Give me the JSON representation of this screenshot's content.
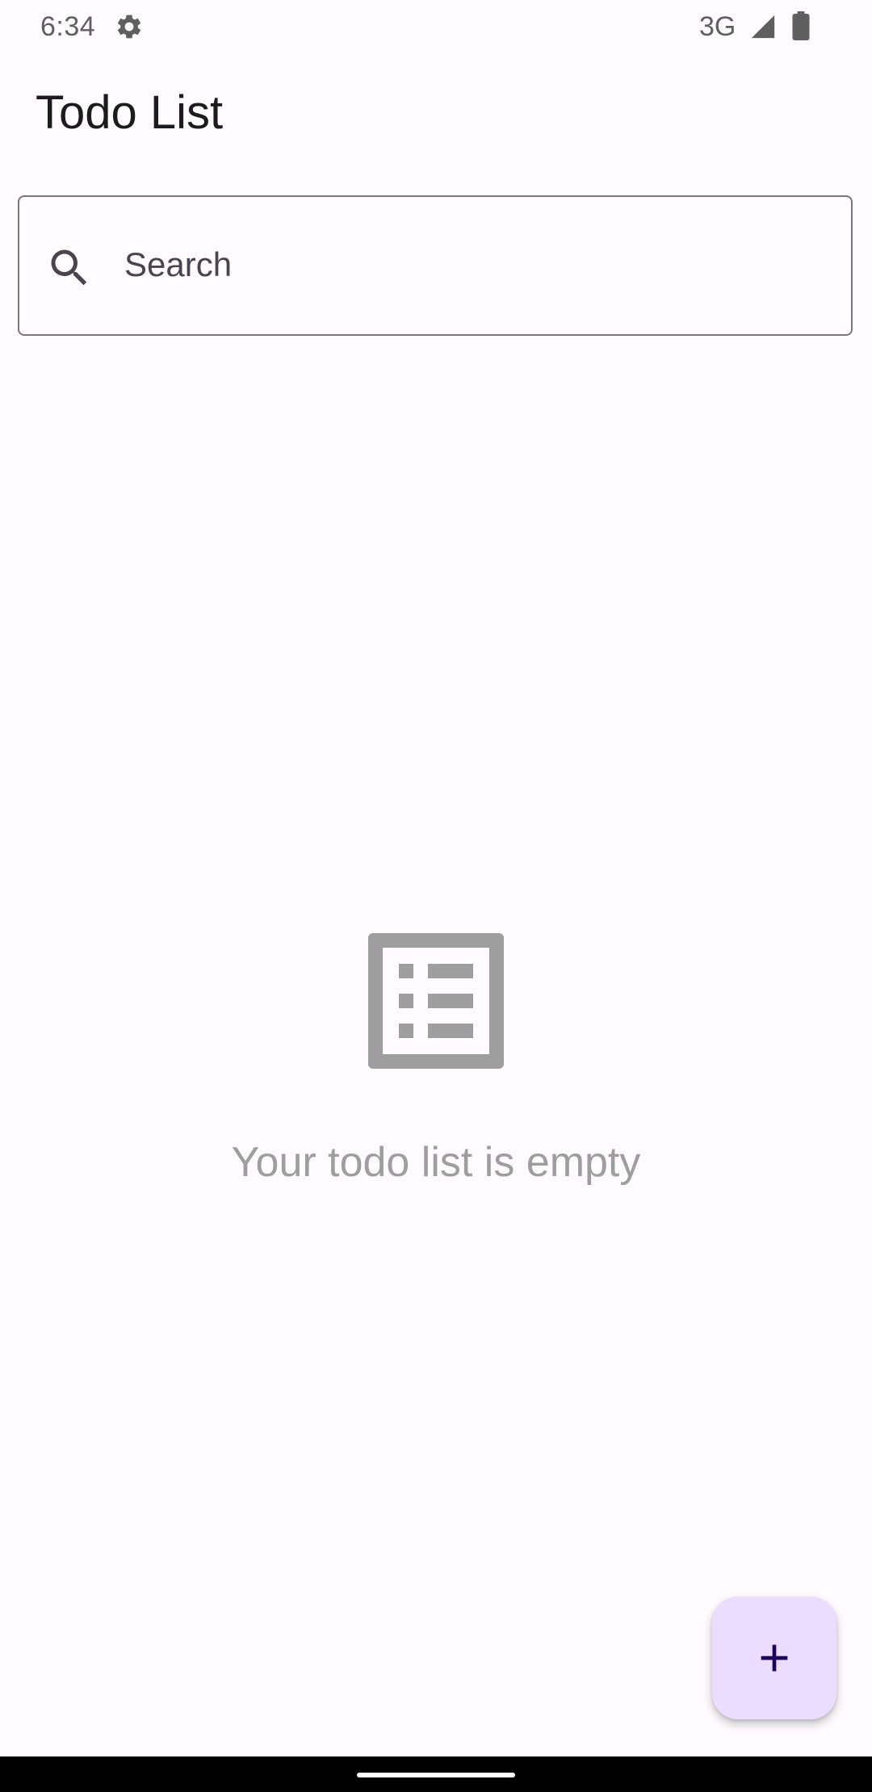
{
  "status_bar": {
    "time": "6:34",
    "network": "3G",
    "icons": [
      "gear-icon",
      "signal-icon",
      "battery-icon"
    ]
  },
  "app": {
    "title": "Todo List"
  },
  "search": {
    "placeholder": "Search",
    "value": "",
    "icon": "search-icon"
  },
  "empty_state": {
    "icon": "list-icon",
    "message": "Your todo list is empty"
  },
  "fab": {
    "icon": "plus-icon",
    "aria_label": "Add todo"
  },
  "colors": {
    "background": "#FFFBFE",
    "title_text": "#1C1B1F",
    "outline": "#79747E",
    "empty_gray": "#9E9E9E",
    "fab_container": "#EADDFF",
    "fab_icon": "#21005D",
    "nav_bar": "#000000"
  }
}
